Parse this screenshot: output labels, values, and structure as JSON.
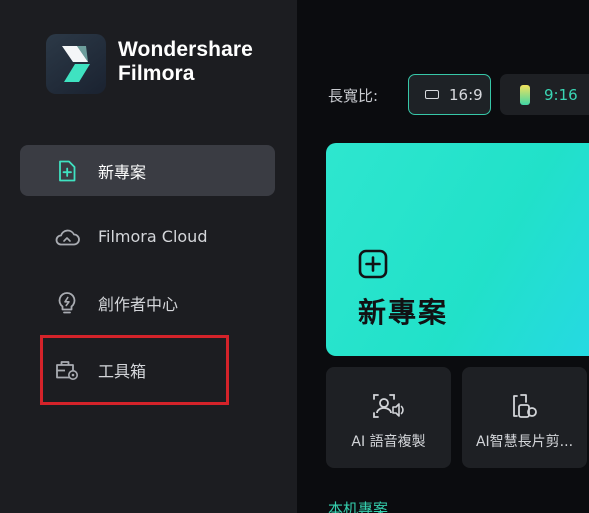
{
  "app": {
    "brand_line1": "Wondershare",
    "brand_line2": "Filmora",
    "logo_icon": "filmora-logo-icon"
  },
  "sidebar": {
    "items": [
      {
        "label": "新專案",
        "icon": "new-project-icon",
        "active": true
      },
      {
        "label": "Filmora Cloud",
        "icon": "cloud-icon",
        "active": false
      },
      {
        "label": "創作者中心",
        "icon": "lightbulb-icon",
        "active": false
      },
      {
        "label": "工具箱",
        "icon": "toolbox-icon",
        "active": false,
        "highlighted": true
      }
    ]
  },
  "aspect_ratio": {
    "label": "長寬比:",
    "options": [
      {
        "label": "16:9",
        "selected": true
      },
      {
        "label": "9:16",
        "selected": false
      }
    ]
  },
  "hero": {
    "title": "新專案",
    "icon": "plus-square-icon"
  },
  "tools": [
    {
      "label": "AI 語音複製",
      "icon": "voice-clone-icon"
    },
    {
      "label": "AI智慧長片剪...",
      "icon": "smart-cut-icon"
    }
  ],
  "section": {
    "partial_label": "本机專案"
  },
  "colors": {
    "accent": "#2ee6cf",
    "accent_text": "#35cfae",
    "sidebar_bg": "#1c1d21",
    "main_bg": "#0b0c0f",
    "highlight_border": "#d4232a"
  }
}
